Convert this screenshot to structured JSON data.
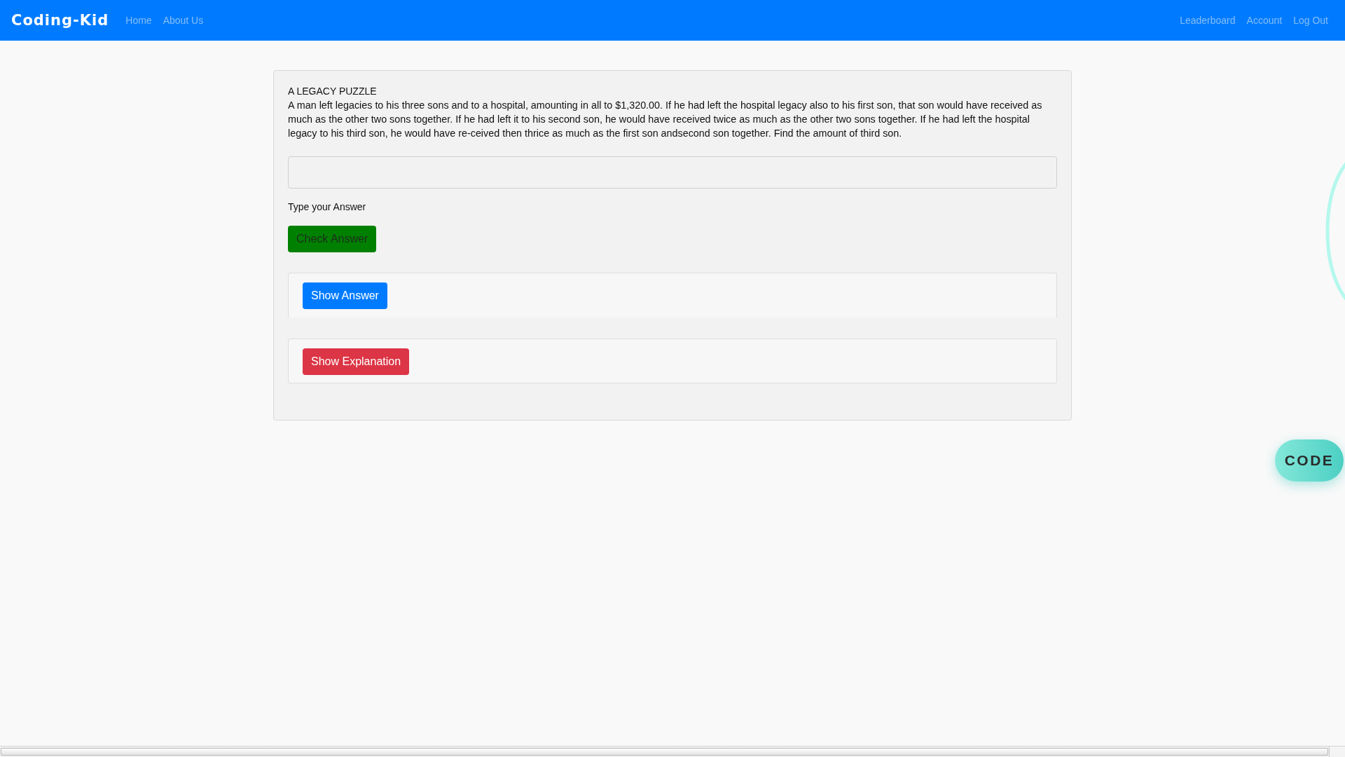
{
  "navbar": {
    "brand": "Coding-Kid",
    "left_links": [
      "Home",
      "About Us"
    ],
    "right_links": [
      "Leaderboard",
      "Account",
      "Log Out"
    ]
  },
  "puzzle": {
    "title": "A LEGACY PUZZLE",
    "text": "A man left legacies to his three sons and to a hospital, amounting in all to $1,320.00. If he had left the hospital legacy also to his first son, that son would have received as much as the other two sons together. If he had left it to his second son, he would have received twice as much as the other two sons together. If he had left the hospital legacy to his third son, he would have re-ceived then thrice as much as the first son andsecond son together. Find the amount of third son.",
    "answer_label": "Type your Answer",
    "check_button": "Check Answer",
    "show_answer_button": "Show Answer",
    "show_explanation_button": "Show Explanation"
  },
  "code_button": "CODE"
}
